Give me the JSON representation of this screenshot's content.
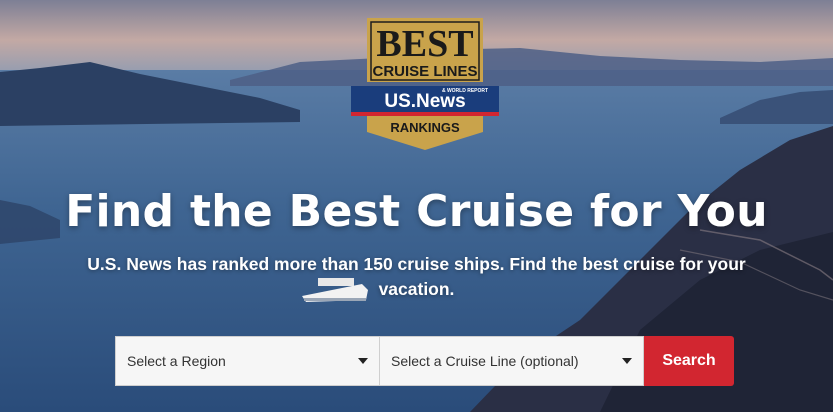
{
  "badge": {
    "top_word": "BEST",
    "sub_word": "CRUISE LINES",
    "brand_small": "& WORLD REPORT",
    "brand": "US.News",
    "bottom_word": "RANKINGS",
    "colors": {
      "gold": "#c9a34b",
      "navy": "#1a3d7c",
      "red": "#d22630"
    }
  },
  "hero": {
    "headline": "Find the Best Cruise for You",
    "subtitle": "U.S. News has ranked more than 150 cruise ships. Find the best cruise for your vacation."
  },
  "search": {
    "region_placeholder": "Select a Region",
    "cruise_line_placeholder": "Select a Cruise Line (optional)",
    "button_label": "Search",
    "button_color": "#d22630"
  }
}
